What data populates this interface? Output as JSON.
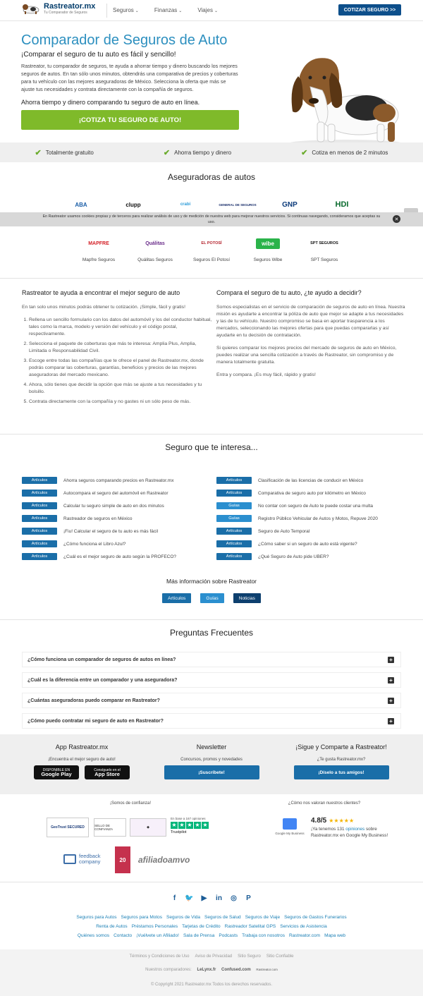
{
  "header": {
    "brand": "Rastreator.mx",
    "tagline": "Tu Comparador de Seguros",
    "nav": [
      "Seguros",
      "Finanzas",
      "Viajes"
    ],
    "cta": "COTIZAR SEGURO >>"
  },
  "hero": {
    "title": "Comparador de Seguros de Auto",
    "subtitle": "¡Comparar el seguro de tu auto es fácil y sencillo!",
    "body": "Rastreator, tu comparador de seguros, te ayuda a ahorrar tiempo y dinero buscando los mejores seguros de autos. En tan sólo unos minutos, obtendrás una comparativa de precios y coberturas para tu vehículo con las mejores aseguradoras de México. Selecciona la oferta que más se ajuste tus necesidades y contrata directamente con la compañía de seguros.",
    "tagline2": "Ahorra tiempo y dinero comparando tu seguro de auto en línea.",
    "cta": "¡COTIZA TU SEGURO DE AUTO!"
  },
  "features": [
    "Totalmente gratuito",
    "Ahorra tiempo y dinero",
    "Cotiza en menos de 2 minutos"
  ],
  "insurers": {
    "title": "Aseguradoras de autos",
    "row1": [
      "ABA",
      "clupp",
      "crabi",
      "GENERAL DE SEGUROS",
      "GNP",
      "HDI"
    ],
    "row2": [
      {
        "logo": "MAPFRE",
        "name": "Mapfre Seguros"
      },
      {
        "logo": "Quálitas",
        "name": "Quálitas Seguros"
      },
      {
        "logo": "EL POTOSÍ",
        "name": "Seguros El Potosí"
      },
      {
        "logo": "wibe",
        "name": "Seguros Wibe"
      },
      {
        "logo": "SPT SEGUROS",
        "name": "SPT Seguros"
      }
    ]
  },
  "cookie": "En Rastreator usamos cookies propias y de terceros para realizar análisis de uso y de medición de nuestra web para mejorar nuestros servicios. Si continuas navegando, consideramos que aceptas su uso.",
  "help": {
    "title": "Rastreator te ayuda a encontrar el mejor seguro de auto",
    "intro": "En tan solo unos minutos podrás obtener tu cotización. ¡Simple, fácil y gratis!",
    "steps": [
      "Rellena un sencillo formulario con los datos del automóvil y los del conductor habitual, tales como la marca, modelo y versión del vehículo y el código postal, respectivamente.",
      "Selecciona el paquete de coberturas que más te interesa: Amplia Plus, Amplia, Limitada o Responsabilidad Civil.",
      "Escoge entre todas las compañías que te ofrece el panel de Rastreator.mx, donde podrás comparar las coberturas, garantías, beneficios y precios de las mejores aseguradoras del mercado mexicano.",
      "Ahora, sólo tienes que decidir la opción que más se ajuste a tus necesidades y tu bolsillo.",
      "Contrata directamente con la compañía y no gastes ni un sólo peso de más."
    ]
  },
  "compare": {
    "title": "Compara el seguro de tu auto, ¿te ayudo a decidir?",
    "p1": "Somos especialistas en el servicio de comparación de seguros de auto en línea. Nuestra misión es ayudarte a encontrar la póliza de auto que mejor se adapte a tus necesidades y las de tu vehículo. Nuestro compromiso se basa en aportar trasparencia a los mercados, seleccionando las mejores ofertas para que puedas compararlas y así ayudarte en tu decisión de contratación.",
    "p2": "Si quieres comparar los mejores precios del mercado de seguros de auto en México, puedes realizar una sencilla cotización a través de Rastreator, sin compromiso y de manera totalmente gratuita.",
    "p3": "Entra y compara. ¡Es muy fácil, rápido y gratis!"
  },
  "interest": {
    "title": "Seguro que te interesa...",
    "left": [
      {
        "tag": "Artículos",
        "text": "Ahorra seguros comparando precios en Rastreator.mx"
      },
      {
        "tag": "Artículos",
        "text": "Autocompara el seguro del automóvil en Rastreator"
      },
      {
        "tag": "Artículos",
        "text": "Calcular tu seguro simple de auto en dos minutos"
      },
      {
        "tag": "Artículos",
        "text": "Rastreador de seguros en México"
      },
      {
        "tag": "Artículos",
        "text": "¡Fiu! Calcular el seguro de tu auto es más fácil"
      },
      {
        "tag": "Artículos",
        "text": "¿Cómo funciona el Libro Azul?"
      },
      {
        "tag": "Artículos",
        "text": "¿Cuál es el mejor seguro de auto según la PROFECO?"
      }
    ],
    "right": [
      {
        "tag": "Artículos",
        "text": "Clasificación de las licencias de conducir en México"
      },
      {
        "tag": "Artículos",
        "text": "Comparativa de seguro auto por kilómetro en México"
      },
      {
        "tag": "Guías",
        "text": "No contar con seguro de Auto te puede costar una multa"
      },
      {
        "tag": "Guías",
        "text": "Registro Público Vehicular de Autos y Motos, Repuve 2020"
      },
      {
        "tag": "Artículos",
        "text": "Seguro de Auto Temporal"
      },
      {
        "tag": "Artículos",
        "text": "¿Cómo saber si un seguro de auto está vigente?"
      },
      {
        "tag": "Artículos",
        "text": "¿Qué Seguro de Auto pide UBER?"
      }
    ],
    "more": "Más información sobre Rastreator",
    "tabs": [
      "Artículos",
      "Guías",
      "Noticias"
    ]
  },
  "faq": {
    "title": "Preguntas Frecuentes",
    "items": [
      "¿Cómo funciona un comparador de seguros de autos en línea?",
      "¿Cuál es la diferencia entre un comparador y una aseguradora?",
      "¿Cuántas aseguradoras puedo comparar en Rastreator?",
      "¿Cómo puedo contratar mi seguro de auto en Rastreator?"
    ]
  },
  "footer": {
    "app": {
      "title": "App Rastreator.mx",
      "sub": "¡Encuentra el mejor seguro de auto!",
      "gp_small": "DISPONIBLE EN",
      "gp": "Google Play",
      "as_small": "Consíguelo en el",
      "as": "App Store"
    },
    "news": {
      "title": "Newsletter",
      "sub": "Concursos, promos y novedades",
      "btn": "¡Suscríbete!"
    },
    "share": {
      "title": "¡Sigue y Comparte a Rastreator!",
      "sub": "¿Te gusta Rastreator.mx?",
      "btn": "¡Díselo a tus amigos!"
    },
    "trust_title": "¡Somos de confianza!",
    "rate_title": "¿Cómo nos valoran nuestros clientes?",
    "rating": "4.8/5",
    "rating_text_a": "¡Ya tenemos",
    "rating_count": "131",
    "rating_link": "opiniones",
    "rating_text_b": "sobre Rastreator.mx en Google My Business!",
    "gmb": "Google My Business",
    "geotrust": "GeoTrust SECURED",
    "sello": "SELLO DE CONFIANZA",
    "amvo": "afiliadoamvo",
    "feedback": "feedback company",
    "trustpilot": "Trustpilot",
    "tp_text": "En base a 167 opiniones",
    "links1": [
      "Seguros para Autos",
      "Seguros para Motos",
      "Seguros de Vida",
      "Seguros de Salud",
      "Seguros de Viaje",
      "Seguros de Gastos Funerarios"
    ],
    "links2": [
      "Renta de Autos",
      "Préstamos Personales",
      "Tarjetas de Crédito",
      "Rastreador Satelital GPS",
      "Servicios de Asistencia"
    ],
    "links3": [
      "Quiénes somos",
      "Contacto",
      "¡Vuélvete un Afiliado!",
      "Sala de Prensa",
      "Podcasts",
      "Trabaja con nosotros",
      "Rastreator.com",
      "Mapa web"
    ],
    "legal": [
      "Términos y Condiciones de Uso",
      "Aviso de Privacidad",
      "Sitio Seguro",
      "Sitio Confiable"
    ],
    "partners_label": "Nuestros comparadores:",
    "partners": [
      "LeLynx.fr",
      "Confused.com",
      "Rastreator.com"
    ],
    "copyright": "© Copyright 2021 Rastreator.mx Todos los derechos reservados."
  },
  "colors": {
    "primary": "#0d4f8b",
    "accent": "#2c8fbf",
    "green": "#7fba2a",
    "tag": "#1a6ea8",
    "tag_guide": "#2b8fcf"
  }
}
